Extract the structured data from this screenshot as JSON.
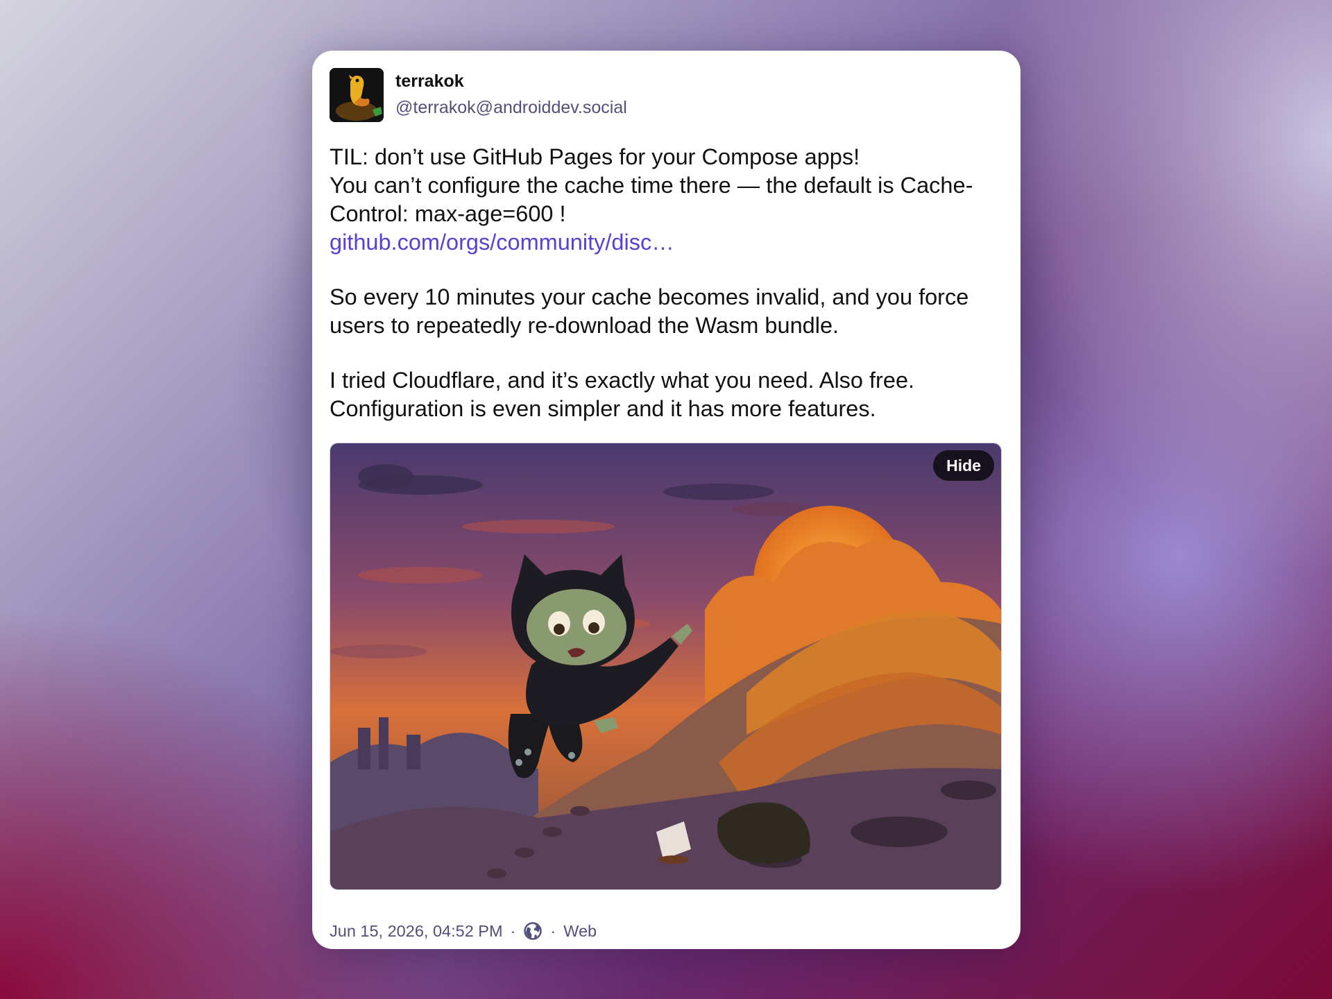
{
  "post": {
    "author": {
      "display_name": "terrakok",
      "handle": "@terrakok@androiddev.social"
    },
    "content": {
      "line1": "TIL: don’t use GitHub Pages for your Compose apps!",
      "line2": "You can’t configure the cache time there — the default is Cache-Control: max-age=600 !",
      "link_text": "github.com/orgs/community/disc…",
      "paragraph2": "So every 10 minutes your cache becomes invalid, and you force users to repeatedly re-download the Wasm bundle.",
      "paragraph3": "I tried Cloudflare, and it’s exactly what you need. Also free. Configuration is even simpler and it has more features."
    },
    "media": {
      "hide_label": "Hide",
      "icon": "image"
    },
    "meta": {
      "timestamp": "Jun 15, 2026, 04:52 PM",
      "separator": "·",
      "visibility_icon": "globe-icon",
      "source": "Web"
    }
  },
  "colors": {
    "link": "#5a3ed6",
    "secondary_text": "#52507a",
    "primary_text": "#111111",
    "card_background": "#ffffff"
  }
}
